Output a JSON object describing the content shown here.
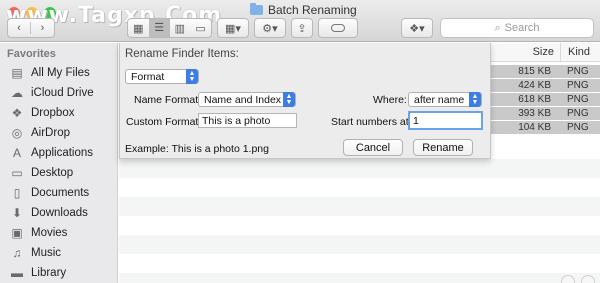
{
  "window": {
    "watermark": "www.Tagxp.Com",
    "title": "Batch Renaming"
  },
  "toolbar": {
    "back_icon": "chevron-left-icon",
    "forward_icon": "chevron-right-icon",
    "arrange_icon": "grid-arrange-icon",
    "action_icon": "gear-icon",
    "share_icon": "share-icon",
    "tag_icon": "tag-icon",
    "dropbox_icon": "dropbox-icon",
    "search_placeholder": "Search"
  },
  "sidebar": {
    "heading": "Favorites",
    "items": [
      {
        "label": "All My Files",
        "icon": "files-icon"
      },
      {
        "label": "iCloud Drive",
        "icon": "cloud-icon"
      },
      {
        "label": "Dropbox",
        "icon": "dropbox-icon"
      },
      {
        "label": "AirDrop",
        "icon": "airdrop-icon"
      },
      {
        "label": "Applications",
        "icon": "applications-icon"
      },
      {
        "label": "Desktop",
        "icon": "desktop-icon"
      },
      {
        "label": "Documents",
        "icon": "documents-icon"
      },
      {
        "label": "Downloads",
        "icon": "downloads-icon"
      },
      {
        "label": "Movies",
        "icon": "movies-icon"
      },
      {
        "label": "Music",
        "icon": "music-icon"
      },
      {
        "label": "Library",
        "icon": "library-icon"
      }
    ]
  },
  "filelist": {
    "columns": {
      "size": "Size",
      "kind": "Kind"
    },
    "rows": [
      {
        "size": "815 KB",
        "kind": "PNG"
      },
      {
        "size": "424 KB",
        "kind": "PNG"
      },
      {
        "size": "618 KB",
        "kind": "PNG"
      },
      {
        "size": "393 KB",
        "kind": "PNG"
      },
      {
        "size": "104 KB",
        "kind": "PNG"
      }
    ]
  },
  "rename_dialog": {
    "title": "Rename Finder Items:",
    "mode_select": "Format",
    "name_format_label": "Name Format:",
    "name_format_value": "Name and Index",
    "where_label": "Where:",
    "where_value": "after name",
    "custom_format_label": "Custom Format:",
    "custom_format_value": "This is a photo",
    "start_numbers_label": "Start numbers at:",
    "start_numbers_value": "1",
    "example_text": "Example: This is a photo 1.png",
    "cancel_label": "Cancel",
    "rename_label": "Rename"
  },
  "colors": {
    "accent": "#3d7ee6",
    "focus_ring": "#6aa2ee",
    "selection": "#c9c9c9"
  }
}
